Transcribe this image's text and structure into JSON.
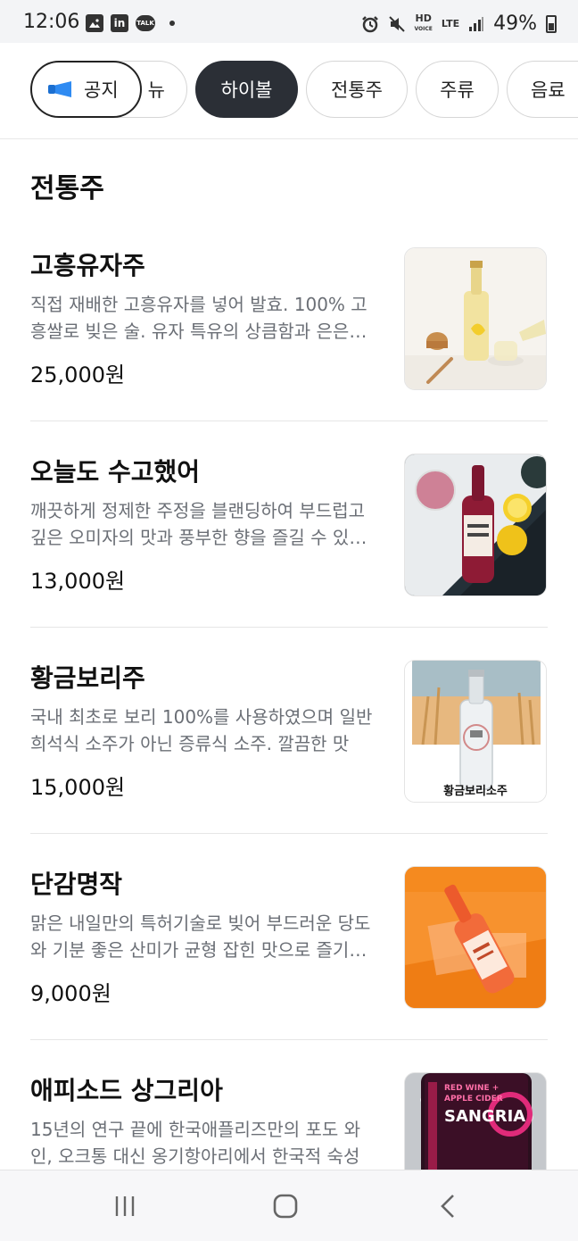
{
  "status_bar": {
    "time": "12:06",
    "left_icons": [
      "gallery-icon",
      "linkedin-icon",
      "kakaotalk-icon",
      "dot-icon"
    ],
    "linkedin_label": "in",
    "talk_label": "TALK",
    "hd_label": "HD",
    "voice_label": "VOICE",
    "lte_label": "LTE",
    "battery": "49%"
  },
  "chips": {
    "notice": "공지",
    "partial": "뉴",
    "items": [
      {
        "label": "하이볼",
        "active": true
      },
      {
        "label": "전통주",
        "active": false
      },
      {
        "label": "주류",
        "active": false
      },
      {
        "label": "음료",
        "active": false
      }
    ]
  },
  "section": {
    "title": "전통주"
  },
  "menu": [
    {
      "name": "고흥유자주",
      "desc": "직접 재배한 고흥유자를 넣어 발효. 100% 고흥쌀로 빚은 술. 유자 특유의 상큼함과 은은한 단맛",
      "price": "25,000원"
    },
    {
      "name": "오늘도 수고했어",
      "desc": "깨끗하게 정제한 주정을 블랜딩하여 부드럽고 깊은 오미자의 맛과 풍부한 향을 즐길 수 있는 술",
      "price": "13,000원"
    },
    {
      "name": "황금보리주",
      "desc": "국내 최초로 보리 100%를 사용하였으며 일반 희석식 소주가 아닌 증류식 소주.  깔끔한 맛",
      "price": "15,000원",
      "image_caption": "황금보리소주"
    },
    {
      "name": "단감명작",
      "desc": "맑은 내일만의 특허기술로 빚어 부드러운 당도와 기분 좋은 산미가 균형 잡힌 맛으로 즐기는 술",
      "price": "9,000원"
    },
    {
      "name": "애피소드 상그리아",
      "desc": "15년의 연구 끝에 한국애플리즈만의 포도 와인, 오크통 대신 옹기항아리에서 한국적 숙성",
      "price": "",
      "image_label_1": "RED WINE +",
      "image_label_2": "APPLE CIDER",
      "image_label_3": "SANGRIA"
    }
  ],
  "colors": {
    "active_chip": "#2b2f36",
    "notice_icon": "#2f8bf2",
    "desc_text": "#6b6f76"
  }
}
